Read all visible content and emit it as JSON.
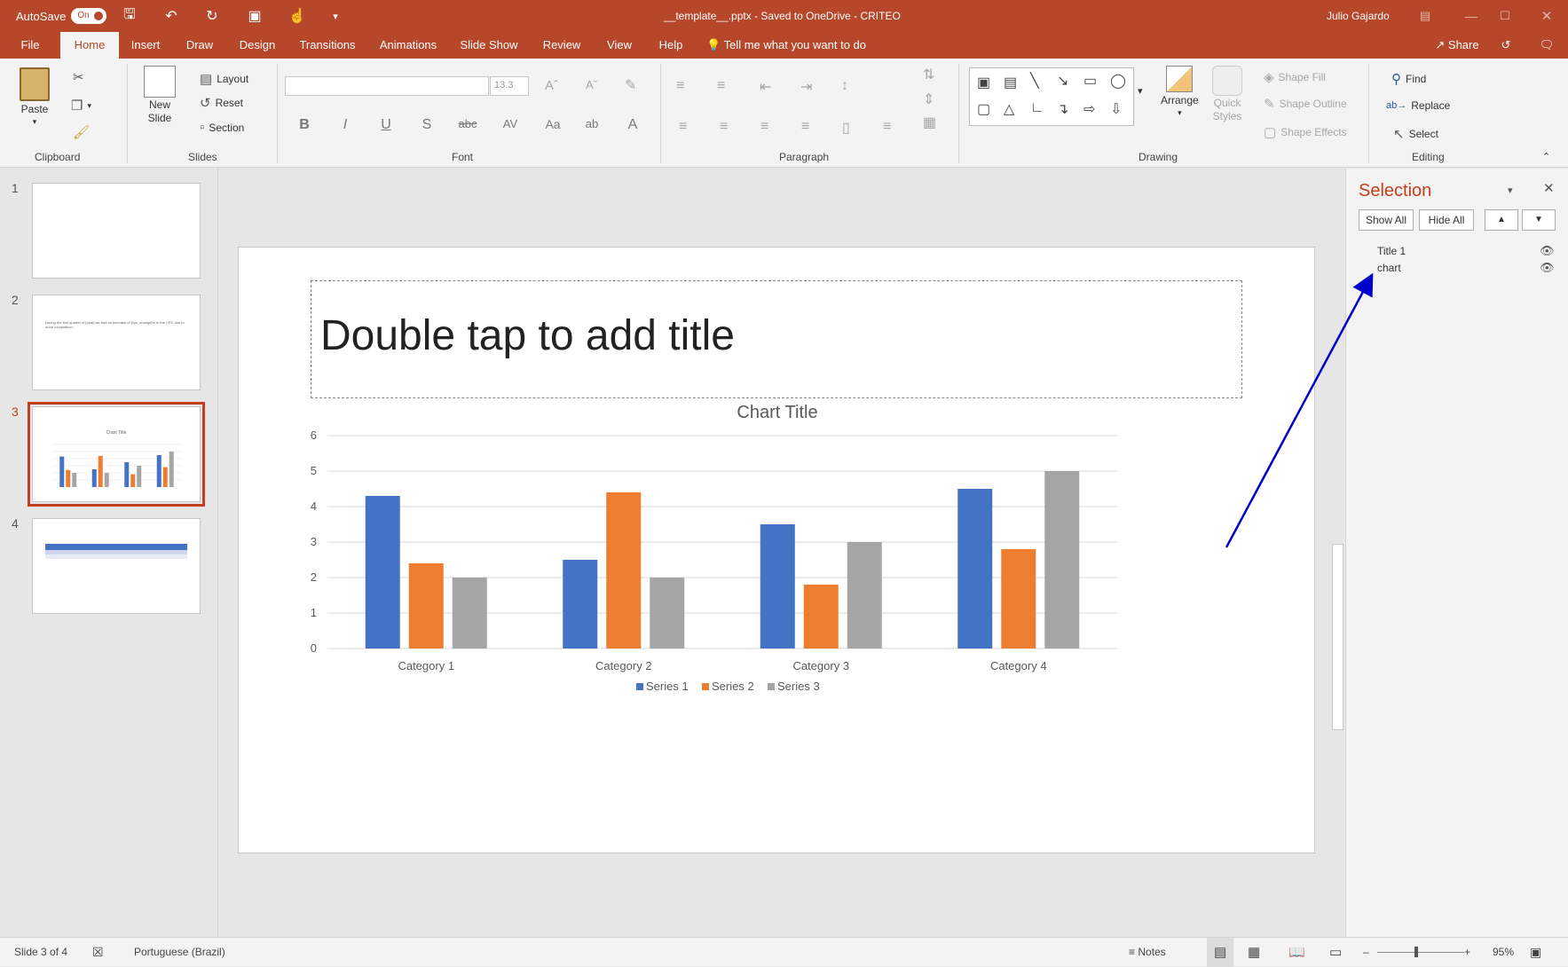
{
  "titlebar": {
    "autosave_label": "AutoSave",
    "autosave_state": "On",
    "doc_title": "__template__.pptx  -  Saved to OneDrive - CRITEO",
    "user": "Julio Gajardo"
  },
  "tabs": [
    {
      "label": "File"
    },
    {
      "label": "Home"
    },
    {
      "label": "Insert"
    },
    {
      "label": "Draw"
    },
    {
      "label": "Design"
    },
    {
      "label": "Transitions"
    },
    {
      "label": "Animations"
    },
    {
      "label": "Slide Show"
    },
    {
      "label": "Review"
    },
    {
      "label": "View"
    },
    {
      "label": "Help"
    }
  ],
  "tell_me": "Tell me what you want to do",
  "share_label": "Share",
  "ribbon": {
    "clipboard": {
      "paste": "Paste",
      "group": "Clipboard"
    },
    "slides": {
      "new_slide": "New",
      "new_slide2": "Slide",
      "layout": "Layout",
      "reset": "Reset",
      "section": "Section",
      "group": "Slides"
    },
    "font": {
      "font_size": "13.3",
      "group": "Font"
    },
    "paragraph": {
      "group": "Paragraph"
    },
    "drawing": {
      "arrange": "Arrange",
      "quick_styles": "Quick",
      "quick_styles2": "Styles",
      "shape_fill": "Shape Fill",
      "shape_outline": "Shape Outline",
      "shape_effects": "Shape Effects",
      "group": "Drawing"
    },
    "editing": {
      "find": "Find",
      "replace": "Replace",
      "select": "Select",
      "group": "Editing"
    }
  },
  "thumbnails": [
    {
      "num": "1"
    },
    {
      "num": "2",
      "text": "During the first quarter of [year] we had an increase of [cpc_change]% in the CPC due to more competition."
    },
    {
      "num": "3"
    },
    {
      "num": "4"
    }
  ],
  "slide": {
    "title_placeholder": "Double tap to add title"
  },
  "chart_data": {
    "type": "bar",
    "title": "Chart Title",
    "categories": [
      "Category 1",
      "Category 2",
      "Category 3",
      "Category 4"
    ],
    "series": [
      {
        "name": "Series 1",
        "values": [
          4.3,
          2.5,
          3.5,
          4.5
        ],
        "color": "#4472c4"
      },
      {
        "name": "Series 2",
        "values": [
          2.4,
          4.4,
          1.8,
          2.8
        ],
        "color": "#ed7d31"
      },
      {
        "name": "Series 3",
        "values": [
          2,
          2,
          3,
          5
        ],
        "color": "#a5a5a5"
      }
    ],
    "ylim": [
      0,
      6
    ],
    "yticks": [
      "0",
      "1",
      "2",
      "3",
      "4",
      "5",
      "6"
    ],
    "grid": true,
    "legend": "bottom"
  },
  "selection_pane": {
    "title": "Selection",
    "show_all": "Show All",
    "hide_all": "Hide All",
    "items": [
      {
        "label": "Title 1"
      },
      {
        "label": "chart"
      }
    ]
  },
  "status": {
    "slide_info": "Slide 3 of 4",
    "language": "Portuguese (Brazil)",
    "notes": "Notes",
    "zoom": "95%"
  },
  "colors": {
    "accent": "#b7472a",
    "selection_title": "#c43e1c",
    "annotation_arrow": "#0000cc"
  }
}
